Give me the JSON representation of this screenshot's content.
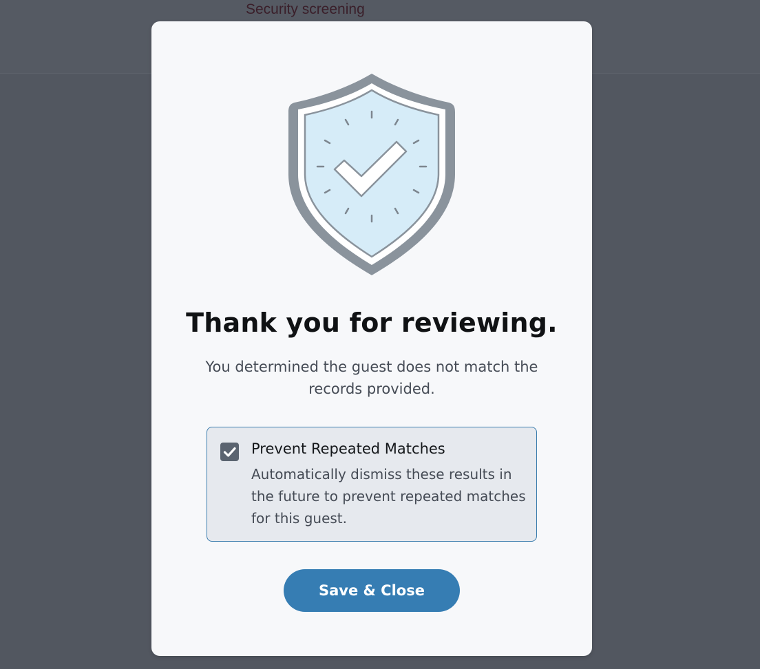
{
  "page": {
    "heading": "Security screening"
  },
  "modal": {
    "illustration": "shield-check-icon",
    "title": "Thank you for reviewing.",
    "description": "You determined the guest does not match the records provided.",
    "option": {
      "checked": true,
      "title": "Prevent Repeated Matches",
      "description": "Automatically dismiss these results in the future to prevent repeated matches for this guest."
    },
    "save_label": "Save & Close"
  },
  "colors": {
    "backdrop": "#525760",
    "modal_bg": "#f7f8fa",
    "accent": "#367db3",
    "option_bg": "#e6e9ee",
    "checkbox": "#5b6470",
    "shield_outline": "#8a939c",
    "shield_fill": "#d6ecf8"
  }
}
